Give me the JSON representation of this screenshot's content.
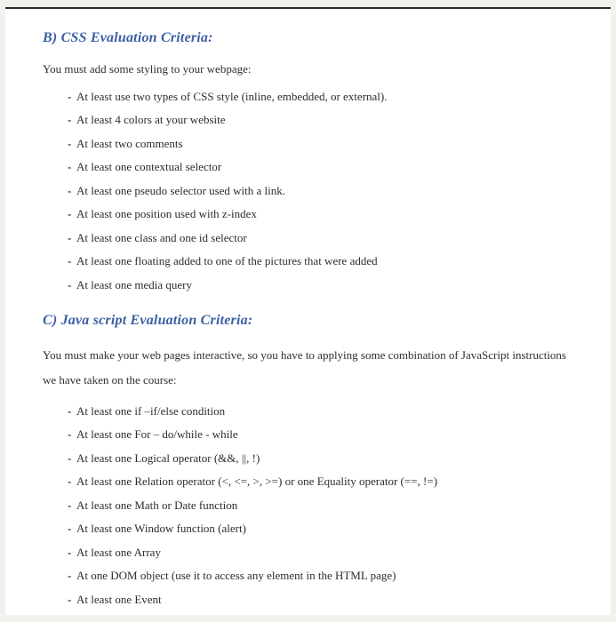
{
  "sectionB": {
    "heading": "B) CSS Evaluation Criteria:",
    "intro": "You must add some styling to your webpage:",
    "items": [
      "At least use two types of CSS style (inline, embedded, or external).",
      "At least 4 colors at your website",
      "At least two comments",
      "At least one contextual selector",
      "At least one pseudo selector used with a link.",
      "At least one position used with z-index",
      "At least one class and one id selector",
      "At least one floating added to one of the pictures that were added",
      "At least one media query"
    ]
  },
  "sectionC": {
    "heading": "C) Java script Evaluation Criteria:",
    "intro": "You must make your web pages interactive, so you have to applying some combination of JavaScript instructions we have taken on the course:",
    "items": [
      " At least one if –if/else condition",
      "At least one For – do/while - while",
      "At least one Logical operator (&&, ||, !)",
      "At least one Relation operator (<, <=, >, >=) or one Equality operator (==, !=)",
      "At least one Math or Date function",
      "At least one Window function (alert)",
      "At least one Array",
      "At one DOM object (use it to access any element in the HTML page)",
      "At least one Event"
    ]
  }
}
